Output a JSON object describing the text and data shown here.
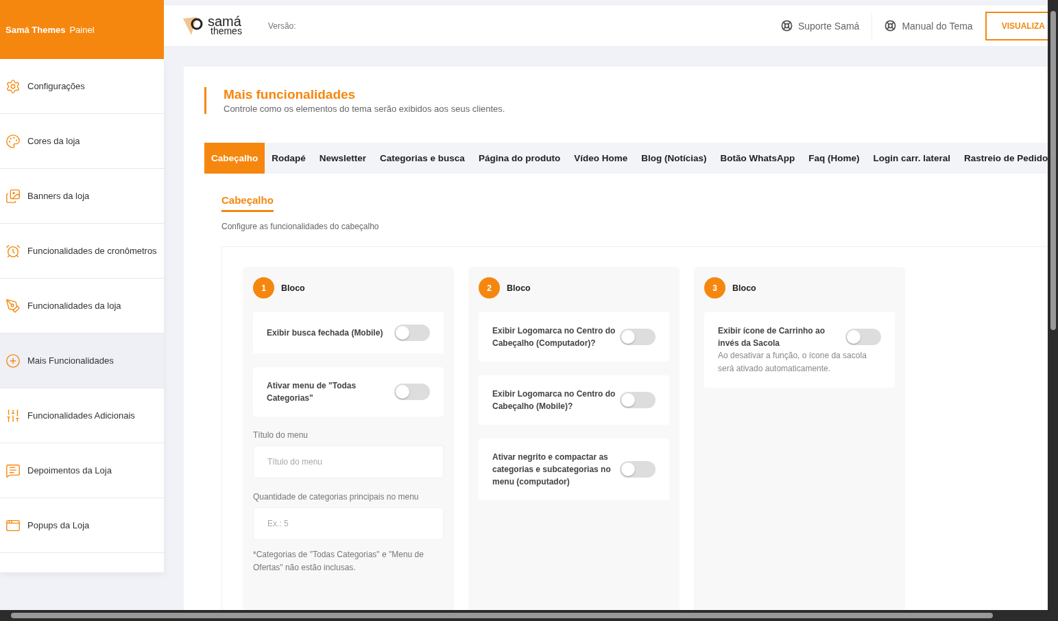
{
  "sidebar": {
    "brand": "Samá Themes",
    "subtitle": "Painel",
    "items": [
      {
        "label": "Configurações",
        "selected": false
      },
      {
        "label": "Cores da loja",
        "selected": false
      },
      {
        "label": "Banners da loja",
        "selected": false
      },
      {
        "label": "Funcionalidades de cronômetros",
        "selected": false
      },
      {
        "label": "Funcionalidades da loja",
        "selected": false
      },
      {
        "label": "Mais Funcionalidades",
        "selected": true
      },
      {
        "label": "Funcionalidades Adicionais",
        "selected": false
      },
      {
        "label": "Depoimentos da Loja",
        "selected": false
      },
      {
        "label": "Popups da Loja",
        "selected": false
      }
    ]
  },
  "topbar": {
    "logo_top": "samá",
    "logo_bottom": "themes",
    "version_label": "Versão:",
    "links": [
      "Suporte Samá",
      "Manual do Tema"
    ],
    "button": "VISUALIZA"
  },
  "page": {
    "title": "Mais funcionalidades",
    "subtitle": "Controle como os elementos do tema serão exibidos aos seus clientes."
  },
  "tabs": [
    {
      "label": "Cabeçalho",
      "selected": true
    },
    {
      "label": "Rodapé",
      "selected": false
    },
    {
      "label": "Newsletter",
      "selected": false
    },
    {
      "label": "Categorias e busca",
      "selected": false
    },
    {
      "label": "Página do produto",
      "selected": false
    },
    {
      "label": "Vídeo Home",
      "selected": false
    },
    {
      "label": "Blog (Notícias)",
      "selected": false
    },
    {
      "label": "Botão WhatsApp",
      "selected": false
    },
    {
      "label": "Faq (Home)",
      "selected": false
    },
    {
      "label": "Login carr. lateral",
      "selected": false
    },
    {
      "label": "Rastreio de Pedido",
      "selected": false
    }
  ],
  "section": {
    "title": "Cabeçalho",
    "description": "Configure as funcionalidades do cabeçalho"
  },
  "blocks": [
    {
      "number": "1",
      "title": "Bloco",
      "items": [
        {
          "kind": "toggle",
          "label": "Exibir busca fechada (Mobile)",
          "on": false
        },
        {
          "kind": "toggle",
          "label": "Ativar menu de \"Todas Categorias\"",
          "on": false
        },
        {
          "kind": "field",
          "label": "Título do menu",
          "placeholder": "Título do menu"
        },
        {
          "kind": "field",
          "label": "Quantidade de categorias principais no menu",
          "placeholder": "Ex.: 5"
        },
        {
          "kind": "note",
          "label": "*Categorias de \"Todas Categorias\" e \"Menu de Ofertas\" não estão inclusas."
        }
      ]
    },
    {
      "number": "2",
      "title": "Bloco",
      "items": [
        {
          "kind": "toggle",
          "label": "Exibir Logomarca no Centro do Cabeçalho (Computador)?",
          "on": false
        },
        {
          "kind": "toggle",
          "label": "Exibir Logomarca no Centro do Cabeçalho (Mobile)?",
          "on": false
        },
        {
          "kind": "toggle",
          "label": "Ativar negrito e compactar as categorias e subcategorias no menu (computador)",
          "on": false
        }
      ]
    },
    {
      "number": "3",
      "title": "Bloco",
      "items": [
        {
          "kind": "toggle",
          "label": "Exibir ícone de Carrinho ao invés da Sacola",
          "hint": "Ao desativar a função, o ícone da sacola será ativado automaticamente.",
          "on": false
        }
      ]
    }
  ]
}
